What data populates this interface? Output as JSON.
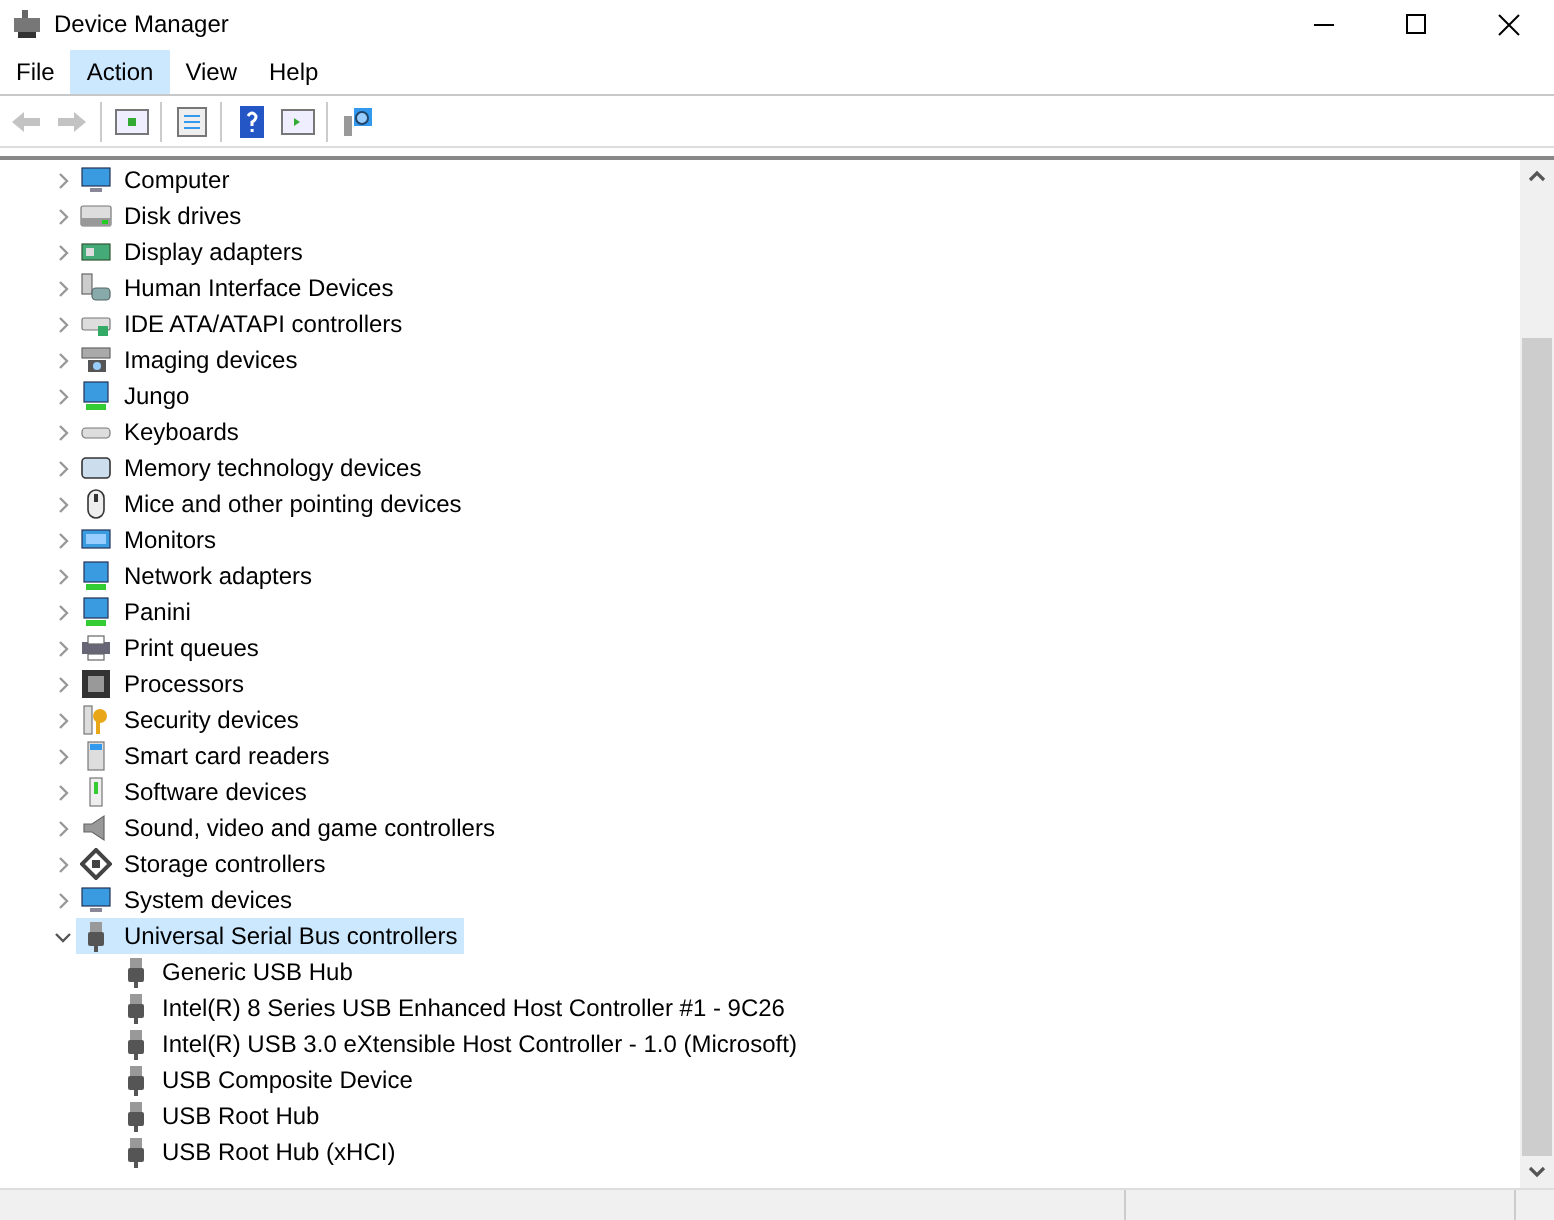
{
  "window": {
    "title": "Device Manager"
  },
  "menu": [
    {
      "label": "File",
      "selected": false
    },
    {
      "label": "Action",
      "selected": true
    },
    {
      "label": "View",
      "selected": false
    },
    {
      "label": "Help",
      "selected": false
    }
  ],
  "tree": [
    {
      "label": "Computer",
      "expanded": false,
      "selected": false
    },
    {
      "label": "Disk drives",
      "expanded": false,
      "selected": false
    },
    {
      "label": "Display adapters",
      "expanded": false,
      "selected": false
    },
    {
      "label": "Human Interface Devices",
      "expanded": false,
      "selected": false
    },
    {
      "label": "IDE ATA/ATAPI controllers",
      "expanded": false,
      "selected": false
    },
    {
      "label": "Imaging devices",
      "expanded": false,
      "selected": false
    },
    {
      "label": "Jungo",
      "expanded": false,
      "selected": false
    },
    {
      "label": "Keyboards",
      "expanded": false,
      "selected": false
    },
    {
      "label": "Memory technology devices",
      "expanded": false,
      "selected": false
    },
    {
      "label": "Mice and other pointing devices",
      "expanded": false,
      "selected": false
    },
    {
      "label": "Monitors",
      "expanded": false,
      "selected": false
    },
    {
      "label": "Network adapters",
      "expanded": false,
      "selected": false
    },
    {
      "label": "Panini",
      "expanded": false,
      "selected": false
    },
    {
      "label": "Print queues",
      "expanded": false,
      "selected": false
    },
    {
      "label": "Processors",
      "expanded": false,
      "selected": false
    },
    {
      "label": "Security devices",
      "expanded": false,
      "selected": false
    },
    {
      "label": "Smart card readers",
      "expanded": false,
      "selected": false
    },
    {
      "label": "Software devices",
      "expanded": false,
      "selected": false
    },
    {
      "label": "Sound, video and game controllers",
      "expanded": false,
      "selected": false
    },
    {
      "label": "Storage controllers",
      "expanded": false,
      "selected": false
    },
    {
      "label": "System devices",
      "expanded": false,
      "selected": false
    },
    {
      "label": "Universal Serial Bus controllers",
      "expanded": true,
      "selected": true,
      "children": [
        {
          "label": "Generic USB Hub",
          "selected": false
        },
        {
          "label": "Intel(R) 8 Series USB Enhanced Host Controller #1 - 9C26",
          "selected": false
        },
        {
          "label": "Intel(R) USB 3.0 eXtensible Host Controller - 1.0 (Microsoft)",
          "selected": false
        },
        {
          "label": "USB Composite Device",
          "selected": false
        },
        {
          "label": "USB Root Hub",
          "selected": false
        },
        {
          "label": "USB Root Hub (xHCI)",
          "selected": false
        }
      ]
    }
  ]
}
